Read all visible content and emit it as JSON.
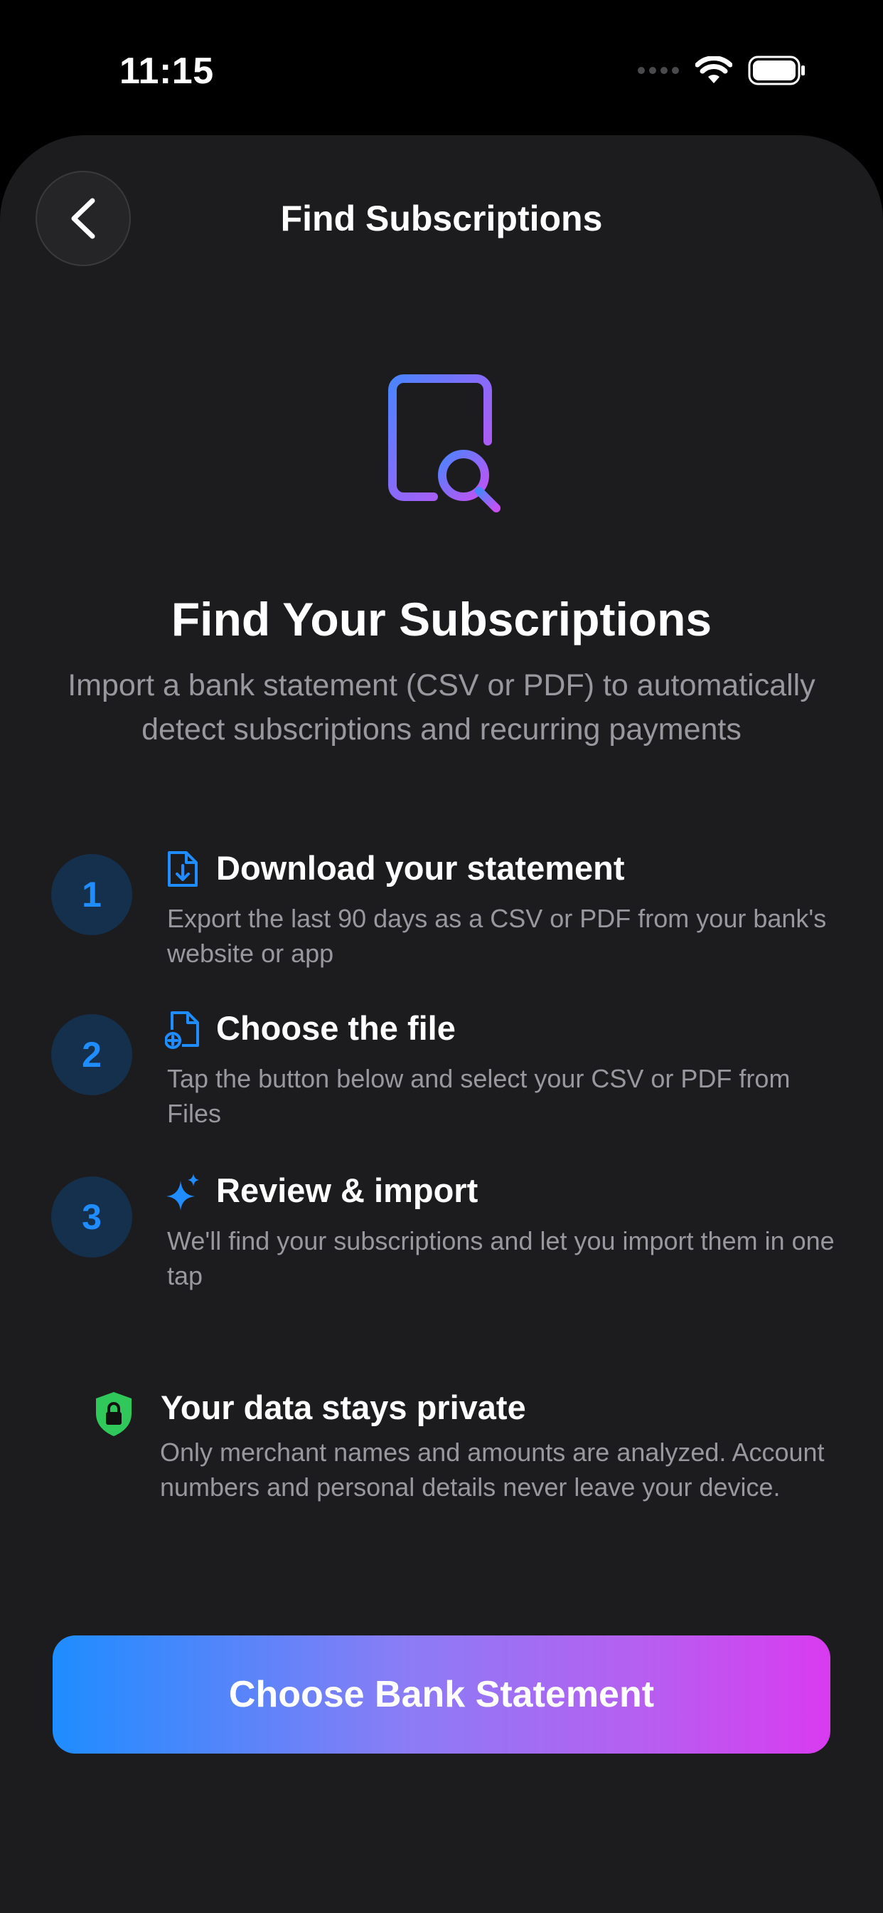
{
  "status_bar": {
    "time": "11:15"
  },
  "nav": {
    "title": "Find Subscriptions"
  },
  "hero": {
    "title": "Find Your Subscriptions",
    "subtitle": "Import a bank statement (CSV or PDF) to automatically detect subscriptions and recurring payments"
  },
  "steps": [
    {
      "number": "1",
      "icon": "doc-download-icon",
      "title": "Download your statement",
      "description": "Export the last 90 days as a CSV or PDF from your bank's website or app"
    },
    {
      "number": "2",
      "icon": "doc-add-icon",
      "title": "Choose the file",
      "description": "Tap the button below and select your CSV or PDF from Files"
    },
    {
      "number": "3",
      "icon": "sparkles-icon",
      "title": "Review & import",
      "description": "We'll find your subscriptions and let you import them in one tap"
    }
  ],
  "privacy": {
    "icon": "shield-lock-icon",
    "title": "Your data stays private",
    "description": "Only merchant names and amounts are analyzed. Account numbers and personal details never leave your device."
  },
  "cta": {
    "label": "Choose Bank Statement"
  },
  "colors": {
    "background": "#1c1c1e",
    "accent_blue": "#1f8cff",
    "accent_purple": "#d93bf0",
    "shield_green": "#30c85a"
  }
}
